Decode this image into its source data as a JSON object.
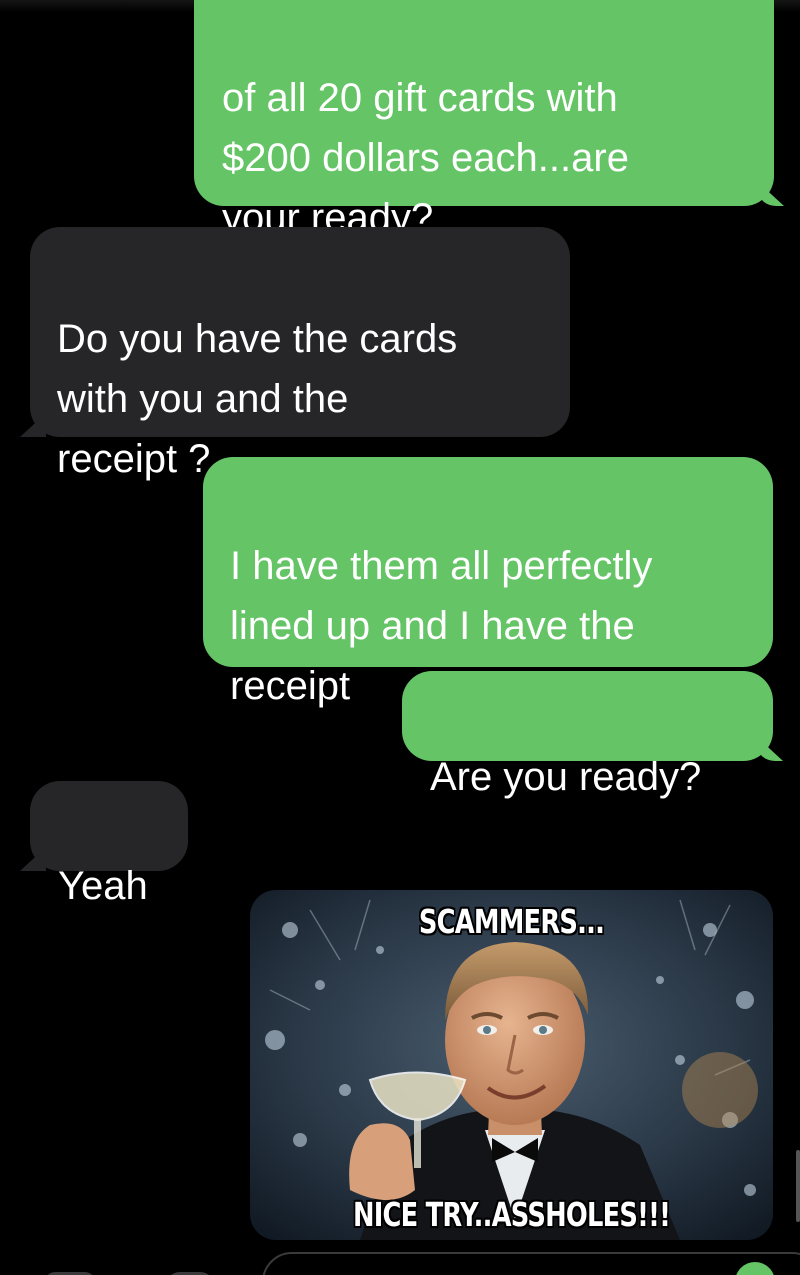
{
  "conversation": {
    "messages": [
      {
        "direction": "sent",
        "text": "of all 20 gift cards with\n$200 dollars each...are\nyour ready?"
      },
      {
        "direction": "received",
        "text": "Do you have the cards\nwith you and the\nreceipt ?"
      },
      {
        "direction": "sent",
        "text": "I have them all perfectly\nlined up and I have the\nreceipt"
      },
      {
        "direction": "sent",
        "text": "Are you ready?"
      },
      {
        "direction": "received",
        "text": "Yeah"
      }
    ],
    "meme": {
      "direction": "sent",
      "top_caption": "SCAMMERS...",
      "bottom_caption": "NICE TRY..ASSHOLES!!!",
      "subject": "man in tuxedo raising champagne glass toast"
    }
  },
  "colors": {
    "sent_bubble": "#65c466",
    "received_bubble": "#262628",
    "background": "#000000"
  },
  "icons": [
    "camera-icon",
    "apps-icon"
  ]
}
